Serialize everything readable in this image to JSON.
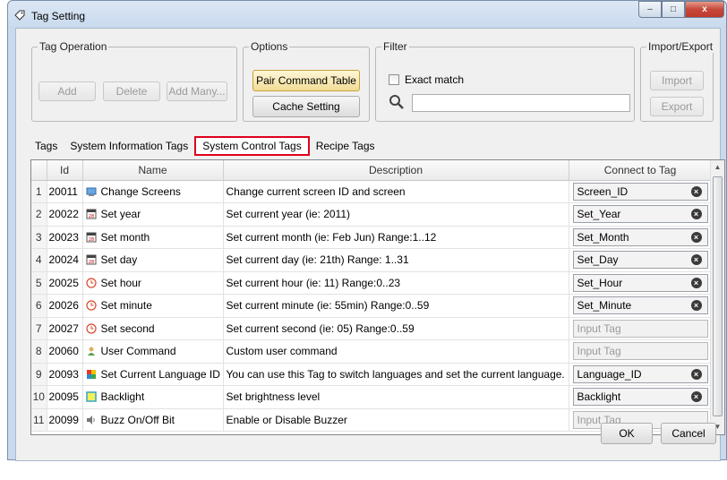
{
  "window": {
    "title": "Tag Setting",
    "controls": {
      "minimize": "–",
      "maximize": "□",
      "close": "x"
    }
  },
  "tag_operation": {
    "label": "Tag Operation",
    "add": "Add",
    "delete": "Delete",
    "add_many": "Add Many..."
  },
  "options": {
    "label": "Options",
    "pair_command_table": "Pair Command Table",
    "cache_setting": "Cache Setting"
  },
  "filter": {
    "label": "Filter",
    "exact_match": "Exact match",
    "exact_match_checked": false,
    "search_value": ""
  },
  "import_export": {
    "label": "Import/Export",
    "import": "Import",
    "export": "Export"
  },
  "tabs": [
    {
      "label": "Tags",
      "active": false
    },
    {
      "label": "System Information Tags",
      "active": false
    },
    {
      "label": "System Control Tags",
      "active": true
    },
    {
      "label": "Recipe Tags",
      "active": false
    }
  ],
  "table": {
    "columns": [
      "",
      "Id",
      "Name",
      "Description",
      "Connect to Tag"
    ],
    "rows": [
      {
        "n": "1",
        "id": "20011",
        "icon": "screen-icon",
        "name": "Change Screens",
        "desc": "Change current screen ID and screen",
        "tag": "Screen_ID",
        "empty": false
      },
      {
        "n": "2",
        "id": "20022",
        "icon": "calendar-icon",
        "name": "Set year",
        "desc": "Set current year (ie: 2011)",
        "tag": "Set_Year",
        "empty": false
      },
      {
        "n": "3",
        "id": "20023",
        "icon": "calendar-icon",
        "name": "Set month",
        "desc": "Set current month (ie: Feb Jun) Range:1..12",
        "tag": "Set_Month",
        "empty": false
      },
      {
        "n": "4",
        "id": "20024",
        "icon": "calendar-icon",
        "name": "Set day",
        "desc": "Set current day (ie: 21th) Range: 1..31",
        "tag": "Set_Day",
        "empty": false
      },
      {
        "n": "5",
        "id": "20025",
        "icon": "clock-icon",
        "name": "Set hour",
        "desc": "Set current hour (ie: 11) Range:0..23",
        "tag": "Set_Hour",
        "empty": false
      },
      {
        "n": "6",
        "id": "20026",
        "icon": "clock-icon",
        "name": "Set minute",
        "desc": "Set current minute (ie: 55min) Range:0..59",
        "tag": "Set_Minute",
        "empty": false
      },
      {
        "n": "7",
        "id": "20027",
        "icon": "clock-icon",
        "name": "Set second",
        "desc": "Set current second (ie: 05) Range:0..59",
        "tag": "Input Tag",
        "empty": true
      },
      {
        "n": "8",
        "id": "20060",
        "icon": "user-icon",
        "name": "User Command",
        "desc": "Custom user command",
        "tag": "Input Tag",
        "empty": true
      },
      {
        "n": "9",
        "id": "20093",
        "icon": "language-icon",
        "name": "Set Current Language ID",
        "desc": "You can use this Tag to switch languages and set the current language.",
        "tag": "Language_ID",
        "empty": false
      },
      {
        "n": "10",
        "id": "20095",
        "icon": "backlight-icon",
        "name": "Backlight",
        "desc": "Set brightness level",
        "tag": "Backlight",
        "empty": false
      },
      {
        "n": "11",
        "id": "20099",
        "icon": "speaker-icon",
        "name": "Buzz On/Off Bit",
        "desc": "Enable or Disable Buzzer",
        "tag": "Input Tag",
        "empty": true
      }
    ]
  },
  "footer": {
    "ok": "OK",
    "cancel": "Cancel"
  },
  "colors": {
    "active_tab_border": "#e0001b",
    "highlight_button": "#f1dc96"
  }
}
